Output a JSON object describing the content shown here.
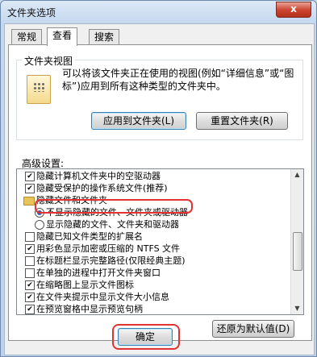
{
  "window": {
    "title": "文件夹选项",
    "close_label": "x"
  },
  "tabs": [
    {
      "label": "常规"
    },
    {
      "label": "查看"
    },
    {
      "label": "搜索"
    }
  ],
  "folder_views": {
    "group_title": "文件夹视图",
    "description": "可以将该文件夹正在使用的视图(例如“详细信息”或“图标”)应用到所有这种类型的文件夹中。",
    "apply_button": "应用到文件夹(L)",
    "reset_button": "重置文件夹(R)"
  },
  "advanced": {
    "label": "高级设置:",
    "items": [
      {
        "label": "隐藏计算机文件夹中的空驱动器",
        "control": "checkbox",
        "checked": true
      },
      {
        "label": "隐藏受保护的操作系统文件(推荐)",
        "control": "checkbox",
        "checked": true
      },
      {
        "label": "隐藏文件和文件夹",
        "control": "folder"
      },
      {
        "label": "不显示隐藏的文件、文件夹或驱动器",
        "control": "radio",
        "checked": true
      },
      {
        "label": "显示隐藏的文件、文件夹和驱动器",
        "control": "radio",
        "checked": false
      },
      {
        "label": "隐藏已知文件类型的扩展名",
        "control": "checkbox",
        "checked": false
      },
      {
        "label": "用彩色显示加密或压缩的 NTFS 文件",
        "control": "checkbox",
        "checked": true
      },
      {
        "label": "在标题栏显示完整路径(仅限经典主题)",
        "control": "checkbox",
        "checked": false
      },
      {
        "label": "在单独的进程中打开文件夹窗口",
        "control": "checkbox",
        "checked": false
      },
      {
        "label": "在缩略图上显示文件图标",
        "control": "checkbox",
        "checked": true
      },
      {
        "label": "在文件夹提示中显示文件大小信息",
        "control": "checkbox",
        "checked": true
      },
      {
        "label": "在预览窗格中显示预览句柄",
        "control": "checkbox",
        "checked": true
      }
    ]
  },
  "restore_button": "还原为默认值(D)",
  "ok_button": "确定",
  "colors": {
    "highlight": "#e33232",
    "radio_dot": "#2a62b5"
  }
}
